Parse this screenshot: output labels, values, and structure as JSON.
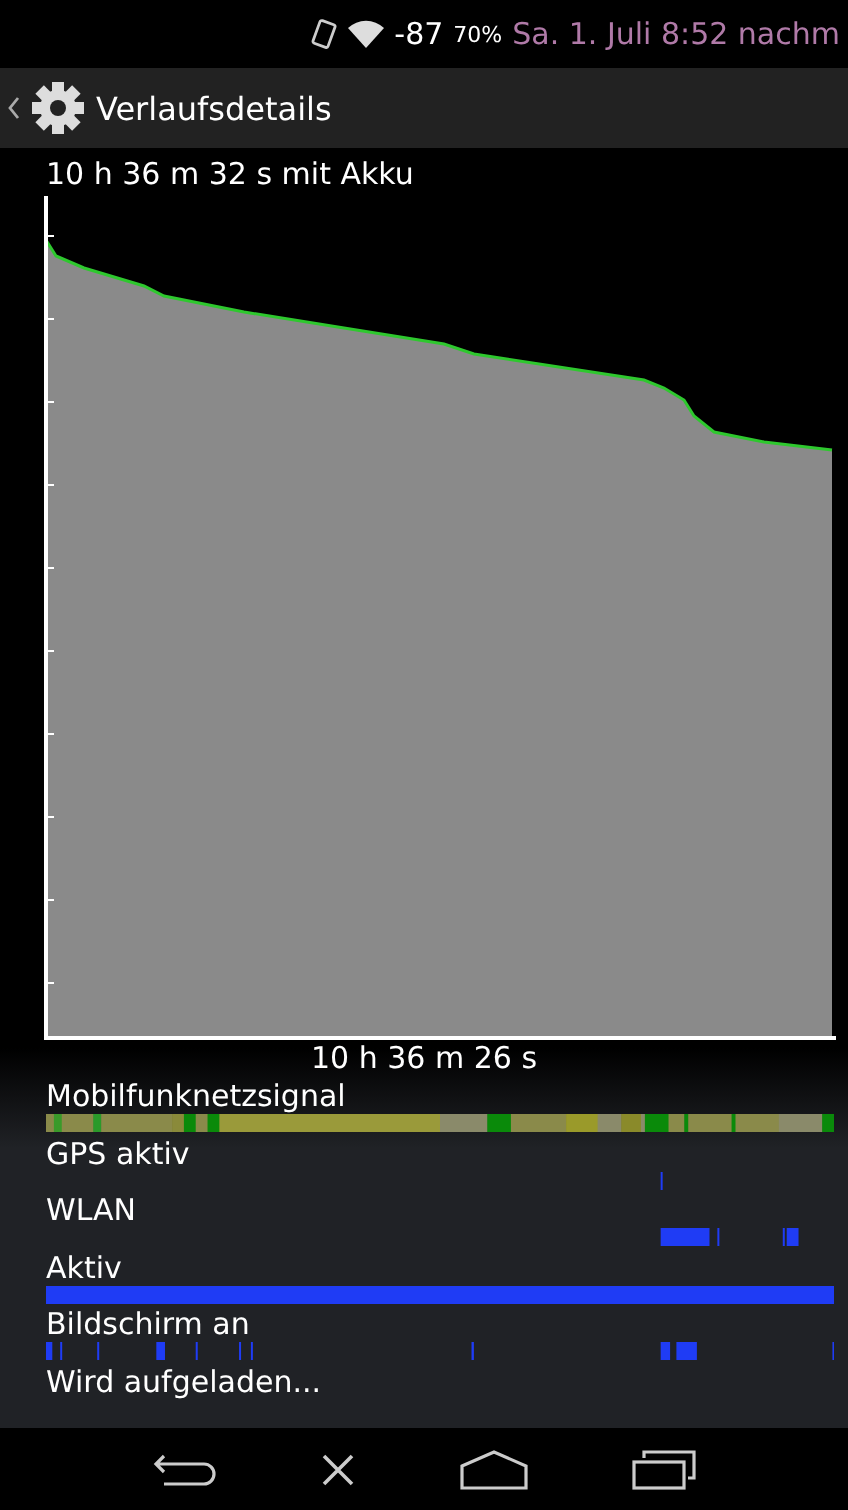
{
  "status_bar": {
    "signal": "-87",
    "battery": "70%",
    "datetime": "Sa. 1. Juli 8:52 nachm"
  },
  "action_bar": {
    "title": "Verlaufsdetails"
  },
  "graph": {
    "title": "10 h 36 m 32 s mit Akku",
    "duration": "10 h 36 m 26 s"
  },
  "rows": [
    {
      "label": "Mobilfunknetzsignal",
      "kind": "signal"
    },
    {
      "label": "GPS aktiv",
      "kind": "gps"
    },
    {
      "label": "WLAN",
      "kind": "wlan"
    },
    {
      "label": "Aktiv",
      "kind": "awake"
    },
    {
      "label": "Bildschirm an",
      "kind": "screen"
    },
    {
      "label": "Wird aufgeladen...",
      "kind": "charging"
    }
  ]
}
